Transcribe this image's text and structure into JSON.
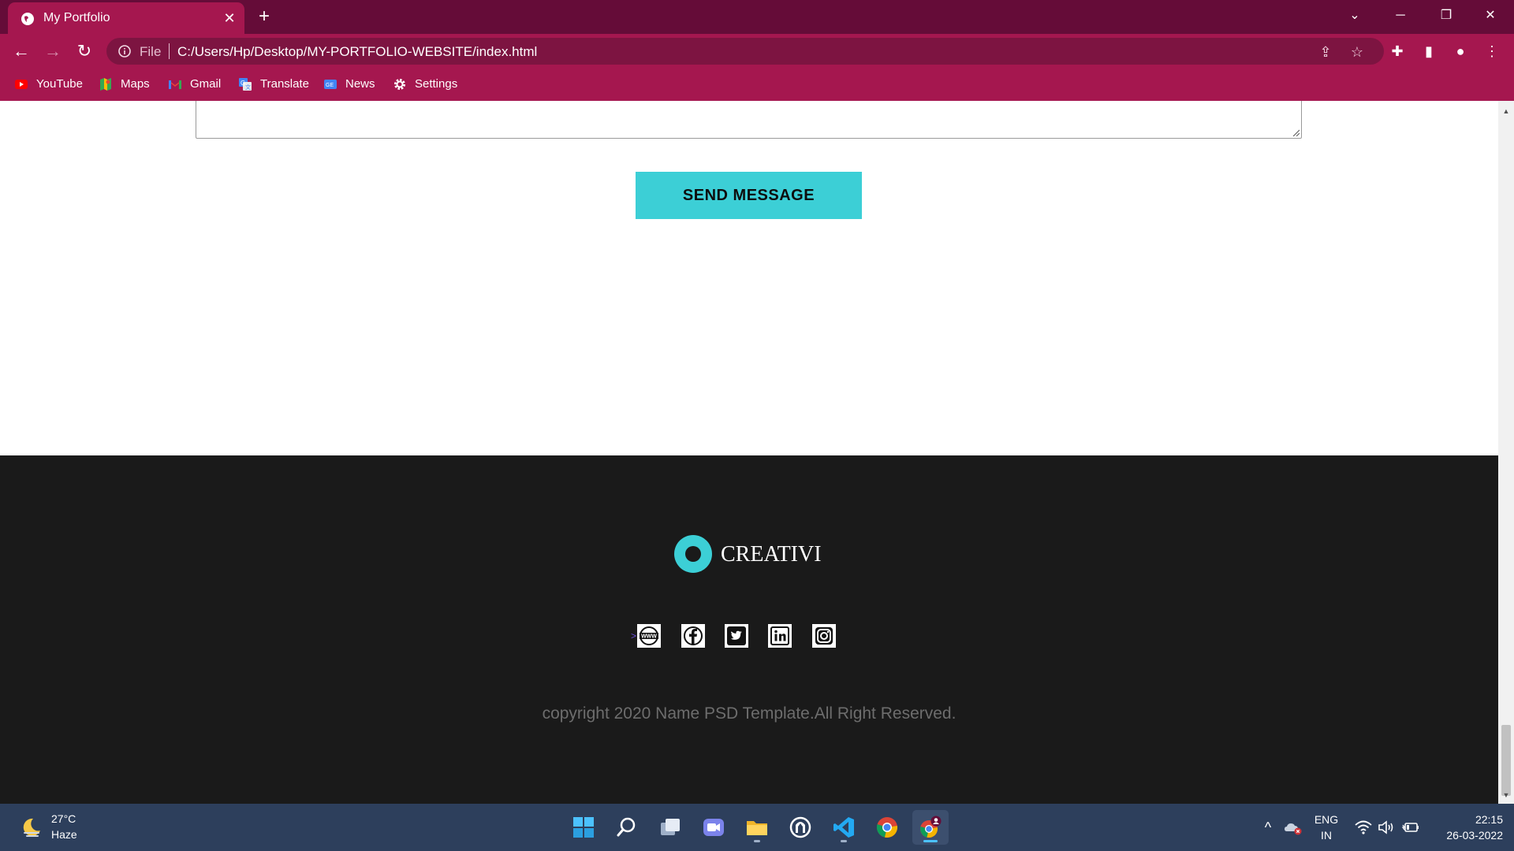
{
  "browser": {
    "tab_title": "My Portfolio",
    "close_tab_glyph": "✕",
    "new_tab_glyph": "+",
    "url_scheme": "File",
    "url": "C:/Users/Hp/Desktop/MY-PORTFOLIO-WEBSITE/index.html",
    "bookmarks": [
      {
        "label": "YouTube",
        "icon": "youtube-icon"
      },
      {
        "label": "Maps",
        "icon": "maps-icon"
      },
      {
        "label": "Gmail",
        "icon": "gmail-icon"
      },
      {
        "label": "Translate",
        "icon": "translate-icon"
      },
      {
        "label": "News",
        "icon": "news-icon"
      },
      {
        "label": "Settings",
        "icon": "gear-icon"
      }
    ],
    "accent_colors": {
      "tab_strip": "#650c38",
      "toolbar": "#a5174f"
    }
  },
  "page": {
    "send_button_label": "SEND MESSAGE",
    "logo_text": "CREATIVI",
    "social_link_text": ">",
    "social_icons": [
      "www-icon",
      "facebook-icon",
      "twitter-icon",
      "linkedin-icon",
      "instagram-icon"
    ],
    "copyright": "copyright 2020 Name PSD Template.All Right Reserved.",
    "colors": {
      "accent": "#3ccfd6",
      "footer_bg": "#1a1a1a"
    }
  },
  "taskbar": {
    "weather_temp": "27°C",
    "weather_condition": "Haze",
    "apps": [
      "start-icon",
      "search-icon",
      "task-view-icon",
      "chat-icon",
      "file-explorer-icon",
      "app-icon",
      "vscode-icon",
      "chrome-icon",
      "chrome-profile-icon"
    ],
    "language": "ENG",
    "region": "IN",
    "time": "22:15",
    "date": "26-03-2022"
  }
}
